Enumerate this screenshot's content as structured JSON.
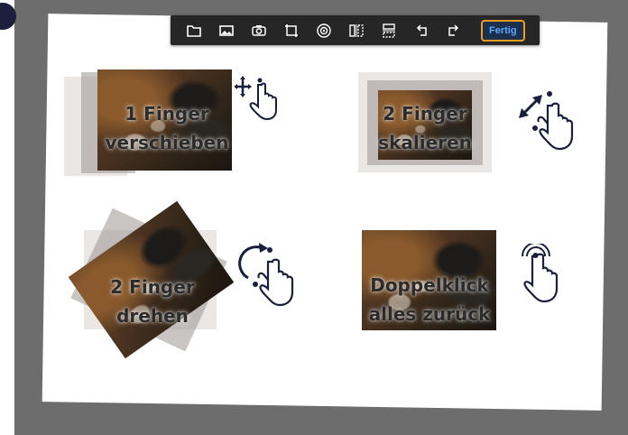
{
  "toolbar": {
    "icons": [
      "folder-icon",
      "image-icon",
      "camera-icon",
      "crop-icon",
      "target-icon",
      "flip-horizontal-icon",
      "flip-vertical-icon",
      "rotate-left-icon",
      "rotate-right-icon"
    ],
    "done_label": "Fertig"
  },
  "tiles": {
    "move": {
      "line1": "1 Finger",
      "line2": "verschieben"
    },
    "scale": {
      "line1": "2 Finger",
      "line2": "skalieren"
    },
    "rotate": {
      "line1": "2 Finger",
      "line2": "drehen"
    },
    "reset": {
      "line1": "Doppelklick",
      "line2": "alles zurück"
    }
  },
  "colors": {
    "toolbar_bg": "#262626",
    "done_border": "#f29b22",
    "done_text": "#58a8ff",
    "background": "#6d6d6d",
    "icon_navy": "#1a1f3c"
  }
}
